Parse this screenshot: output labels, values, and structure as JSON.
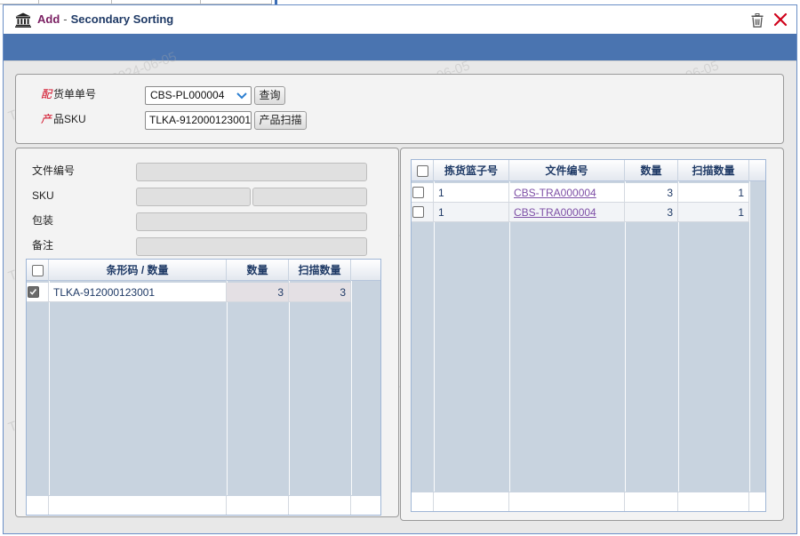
{
  "window": {
    "title_action": "Add",
    "title_separator": "-",
    "title_name": "Secondary Sorting"
  },
  "header_form": {
    "picklist_label_red": "配",
    "picklist_label": "货单单号",
    "picklist_value": "CBS-PL000004",
    "query_button": "查询",
    "sku_label_red": "产",
    "sku_label": "品SKU",
    "sku_value": "TLKA-912000123001",
    "scan_button": "产品扫描"
  },
  "detail_form": {
    "doc_no_label": "文件编号",
    "sku_label": "SKU",
    "package_label": "包装",
    "remark_label": "备注"
  },
  "left_grid": {
    "columns": [
      "条形码 / 数量",
      "数量",
      "扫描数量"
    ],
    "rows": [
      {
        "checked": true,
        "barcode": "TLKA-912000123001",
        "qty": "3",
        "scanned": "3"
      }
    ]
  },
  "right_grid": {
    "columns": [
      "拣货篮子号",
      "文件编号",
      "数量",
      "扫描数量"
    ],
    "rows": [
      {
        "basket": "1",
        "doc": "CBS-TRA000004",
        "qty": "3",
        "scanned": "1"
      },
      {
        "basket": "1",
        "doc": "CBS-TRA000004",
        "qty": "3",
        "scanned": "1"
      }
    ]
  },
  "watermark": "TLKA.CBS.Admin 2024-06-05",
  "colors": {
    "title_action": "#7a1f62",
    "title_name": "#1f3a66",
    "header_bar": "#4a74b0",
    "close": "#d0021b",
    "grid_body": "#c8d3df",
    "link": "#7e4fa6"
  }
}
